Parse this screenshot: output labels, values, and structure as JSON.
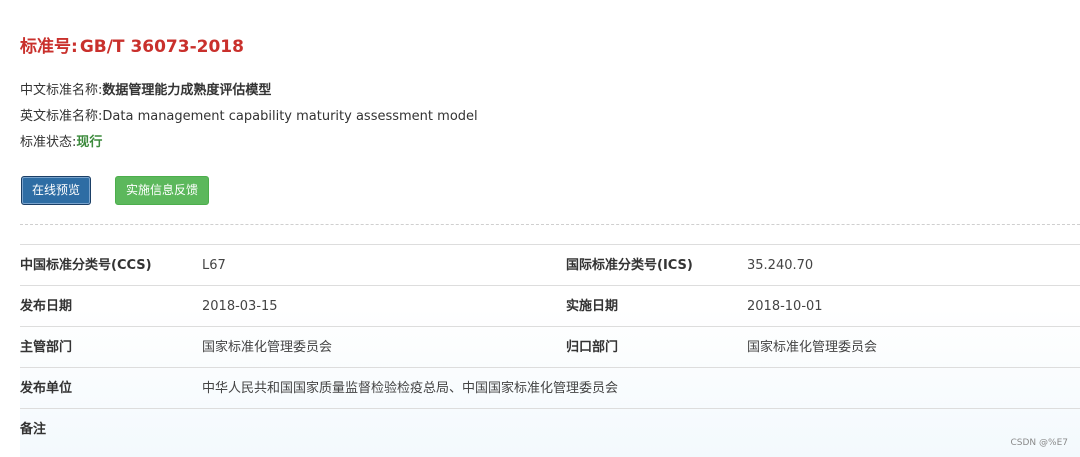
{
  "header": {
    "title_prefix": "标准号:",
    "standard_code": "GB/T 36073-2018"
  },
  "info": {
    "cn_name_label": "中文标准名称:",
    "cn_name": "数据管理能力成熟度评估模型",
    "en_name_label": "英文标准名称:",
    "en_name": "Data management capability maturity assessment model",
    "status_label": "标准状态:",
    "status": "现行"
  },
  "buttons": {
    "preview": "在线预览",
    "feedback": "实施信息反馈"
  },
  "details": {
    "ccs_label": "中国标准分类号(CCS)",
    "ccs": "L67",
    "ics_label": "国际标准分类号(ICS)",
    "ics": "35.240.70",
    "publish_date_label": "发布日期",
    "publish_date": "2018-03-15",
    "implement_date_label": "实施日期",
    "implement_date": "2018-10-01",
    "competent_dept_label": "主管部门",
    "competent_dept": "国家标准化管理委员会",
    "centralized_dept_label": "归口部门",
    "centralized_dept": "国家标准化管理委员会",
    "publisher_label": "发布单位",
    "publisher": "中华人民共和国国家质量监督检验检疫总局、中国国家标准化管理委员会",
    "remarks_label": "备注",
    "remarks": ""
  },
  "watermark": "CSDN @%E7",
  "colors": {
    "title_red": "#c9302c",
    "status_green": "#3c8a3c",
    "preview_blue": "#2e6da4",
    "feedback_green": "#5cb85c"
  }
}
